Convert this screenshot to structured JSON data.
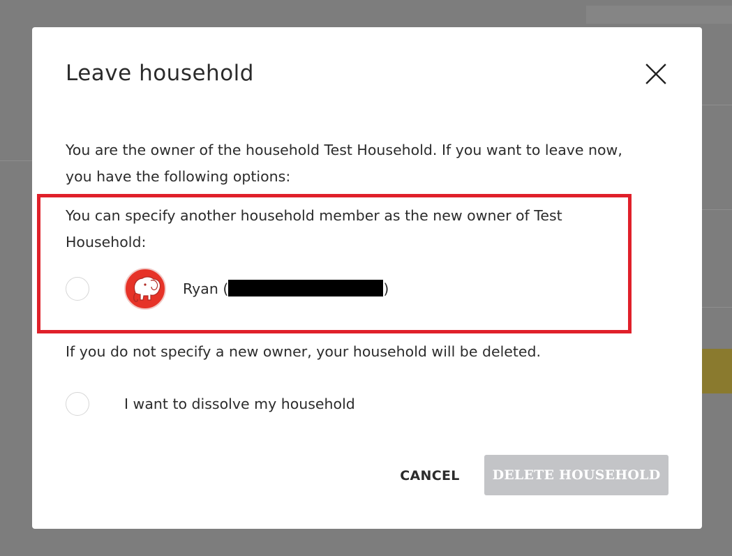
{
  "dialog": {
    "title": "Leave household",
    "intro": "You are the owner of the household Test Household. If you want to leave now, you have the following options:",
    "specify_text": "You can specify another household member as the new owner of Test Household:",
    "member": {
      "name_prefix": "Ryan (",
      "name_suffix": ")",
      "avatar_icon": "elephant-icon"
    },
    "warning": "If you do not specify a new owner, your household will be deleted.",
    "dissolve_label": "I want to dissolve my household",
    "cancel_label": "CANCEL",
    "delete_label": "DELETE HOUSEHOLD",
    "close_icon": "close-icon"
  },
  "colors": {
    "highlight": "#e0202a",
    "avatar_bg": "#e63328",
    "delete_disabled": "#c3c4c7",
    "overlay": "#7d7d7d"
  }
}
